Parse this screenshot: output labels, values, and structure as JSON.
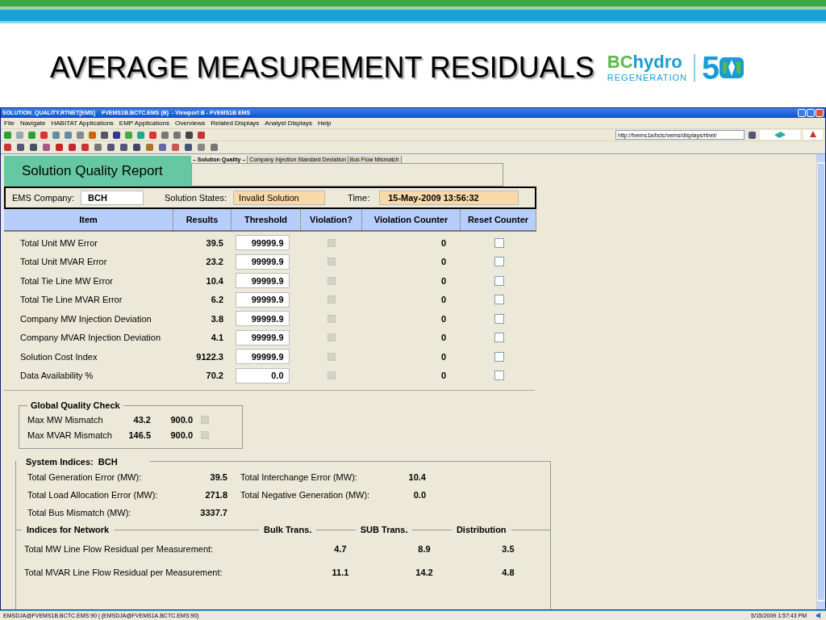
{
  "slide": {
    "title": "AVERAGE MEASUREMENT RESIDUALS",
    "logo": {
      "brand_a": "BC",
      "brand_b": "hydro",
      "tagline": "REGENERATION",
      "anniversary": "5"
    }
  },
  "window": {
    "title": "SOLUTION_QUALITY.RTNET[EMS]    FVEMS1B.BCTC.EMS (B)  - Viewport B - FVEMS1B EMS",
    "menu": [
      "File",
      "Navigate",
      "HABITAT Applications",
      "EMP Applications",
      "Overviews",
      "Related Displays",
      "Analyst Displays",
      "Help"
    ],
    "address": "http://fvems1a/bctc/vems/displays/rtnet/"
  },
  "report": {
    "title": "Solution Quality Report",
    "tabs": [
      {
        "label": "– Solution Quality –",
        "selected": true
      },
      {
        "label": "Company Injection Standard Deviation",
        "selected": false
      },
      {
        "label": "Bus Flow Mismatch",
        "selected": false
      }
    ],
    "company_label": "EMS Company:",
    "company": "BCH",
    "states_label": "Solution States:",
    "state": "Invalid Solution",
    "time_label": "Time:",
    "time": "15-May-2009 13:56:32",
    "columns": [
      "Item",
      "Results",
      "Threshold",
      "Violation?",
      "Violation Counter",
      "Reset Counter"
    ],
    "rows": [
      {
        "item": "Total Unit  MW Error",
        "result": "39.5",
        "threshold": "99999.9",
        "violation": false,
        "counter": "0",
        "reset": false
      },
      {
        "item": "Total Unit  MVAR Error",
        "result": "23.2",
        "threshold": "99999.9",
        "violation": false,
        "counter": "0",
        "reset": false
      },
      {
        "item": "Total Tie Line  MW Error",
        "result": "10.4",
        "threshold": "99999.9",
        "violation": false,
        "counter": "0",
        "reset": false
      },
      {
        "item": "Total Tie Line  MVAR Error",
        "result": "6.2",
        "threshold": "99999.9",
        "violation": false,
        "counter": "0",
        "reset": false
      },
      {
        "item": "Company  MW Injection Deviation",
        "result": "3.8",
        "threshold": "99999.9",
        "violation": false,
        "counter": "0",
        "reset": false
      },
      {
        "item": "Company  MVAR Injection Deviation",
        "result": "4.1",
        "threshold": "99999.9",
        "violation": false,
        "counter": "0",
        "reset": false
      },
      {
        "item": "Solution Cost Index",
        "result": "9122.3",
        "threshold": "99999.9",
        "violation": false,
        "counter": "0",
        "reset": false
      },
      {
        "item": "Data Availability %",
        "result": "70.2",
        "threshold": "0.0",
        "violation": false,
        "counter": "0",
        "reset": false
      }
    ]
  },
  "global_check": {
    "title": "Global Quality Check",
    "rows": [
      {
        "label": "Max  MW Mismatch",
        "value": "43.2",
        "limit": "900.0",
        "violation": false
      },
      {
        "label": "Max  MVAR Mismatch",
        "value": "146.5",
        "limit": "900.0",
        "violation": false
      }
    ]
  },
  "system_indices": {
    "title": "System Indices:",
    "company": "BCH",
    "left": [
      {
        "label": "Total Generation Error (MW):",
        "value": "39.5"
      },
      {
        "label": "Total Load Allocation Error (MW):",
        "value": "271.8"
      },
      {
        "label": "Total Bus Mismatch (MW):",
        "value": "3337.7"
      }
    ],
    "right": [
      {
        "label": "Total Interchange Error (MW):",
        "value": "10.4"
      },
      {
        "label": "Total Negative Generation (MW):",
        "value": "0.0"
      }
    ],
    "network_title": "Indices for Network",
    "network_columns": [
      "Bulk Trans.",
      "SUB Trans.",
      "Distribution"
    ],
    "network_rows": [
      {
        "label": "Total MW Line Flow Residual per Measurement:",
        "values": [
          "4.7",
          "8.9",
          "3.5"
        ]
      },
      {
        "label": "Total MVAR Line Flow Residual per Measurement:",
        "values": [
          "11.1",
          "14.2",
          "4.8"
        ]
      }
    ]
  },
  "status_bar": {
    "left": "EMSDJA@FVEMS1B.BCTC.EMS:90 | (EMSDJA@FVEMS1A.BCTC.EMS:90)",
    "right": "5/15/2009 1:57:43 PM"
  }
}
